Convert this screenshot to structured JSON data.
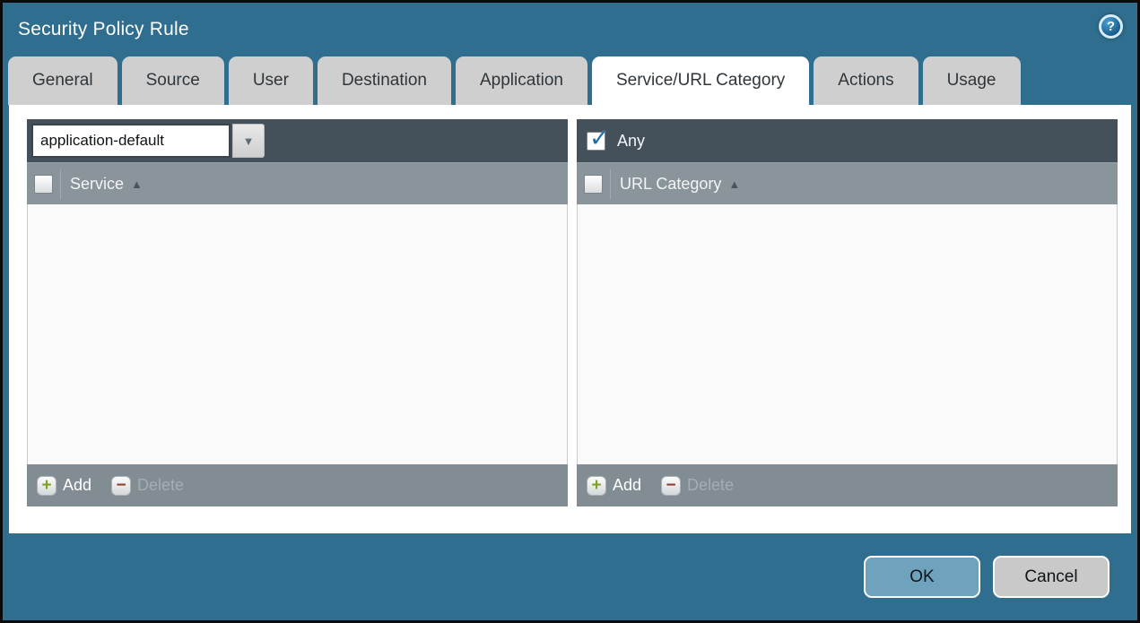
{
  "window": {
    "title": "Security Policy Rule"
  },
  "icons": {
    "help": "?",
    "dropdown_arrow": "▼",
    "sort_asc": "▲",
    "check": "✓",
    "plus": "+",
    "minus": "−"
  },
  "tabs": [
    {
      "label": "General"
    },
    {
      "label": "Source"
    },
    {
      "label": "User"
    },
    {
      "label": "Destination"
    },
    {
      "label": "Application"
    },
    {
      "label": "Service/URL Category"
    },
    {
      "label": "Actions"
    },
    {
      "label": "Usage"
    }
  ],
  "active_tab": "Service/URL Category",
  "service_panel": {
    "service_selector": {
      "value": "application-default"
    },
    "column_header": "Service",
    "rows": [],
    "toolbar": {
      "add_label": "Add",
      "delete_label": "Delete"
    }
  },
  "url_category_panel": {
    "any_checkbox": {
      "label": "Any",
      "checked": true
    },
    "column_header": "URL Category",
    "rows": [],
    "toolbar": {
      "add_label": "Add",
      "delete_label": "Delete"
    }
  },
  "footer": {
    "ok_label": "OK",
    "cancel_label": "Cancel"
  },
  "colors": {
    "dialog_teal": "#2f6e8e",
    "tab_inactive_gray": "#cfcfcf",
    "tab_active_white": "#ffffff",
    "panel_dark_bar": "#44515b",
    "panel_header_gray": "#8a949b",
    "panel_footer_gray": "#828c93",
    "list_body": "#fafafa",
    "ok_button_blue": "#6fa3bd",
    "cancel_button_gray": "#c9c9c9",
    "checkmark_blue": "#1f6fa8",
    "add_plus_green": "#7da120",
    "delete_minus_red": "#8e3f2f"
  }
}
